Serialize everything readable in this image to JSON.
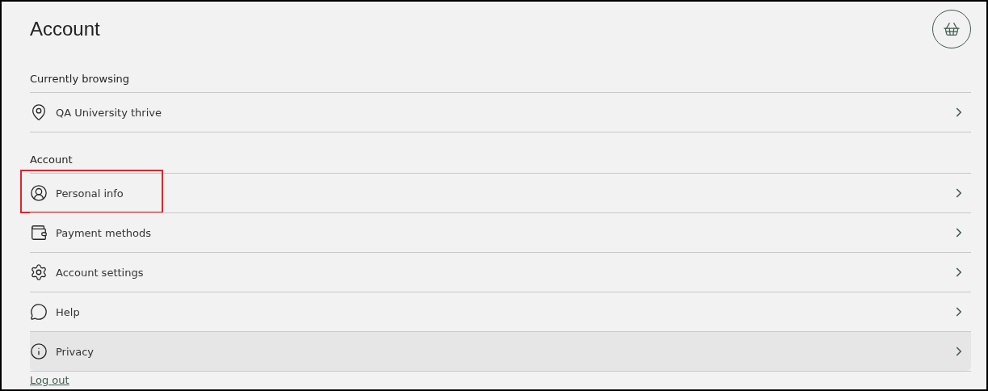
{
  "page": {
    "title": "Account"
  },
  "sections": [
    {
      "heading": "Currently browsing",
      "items": [
        {
          "label": "QA University thrive",
          "highlighted": false,
          "hovered": false
        }
      ]
    },
    {
      "heading": "Account",
      "items": [
        {
          "label": "Personal info",
          "highlighted": true,
          "hovered": false
        },
        {
          "label": "Payment methods",
          "highlighted": false,
          "hovered": false
        },
        {
          "label": "Account settings",
          "highlighted": false,
          "hovered": false
        },
        {
          "label": "Help",
          "highlighted": false,
          "hovered": false
        },
        {
          "label": "Privacy",
          "highlighted": false,
          "hovered": true
        }
      ]
    }
  ],
  "logout": "Log out"
}
